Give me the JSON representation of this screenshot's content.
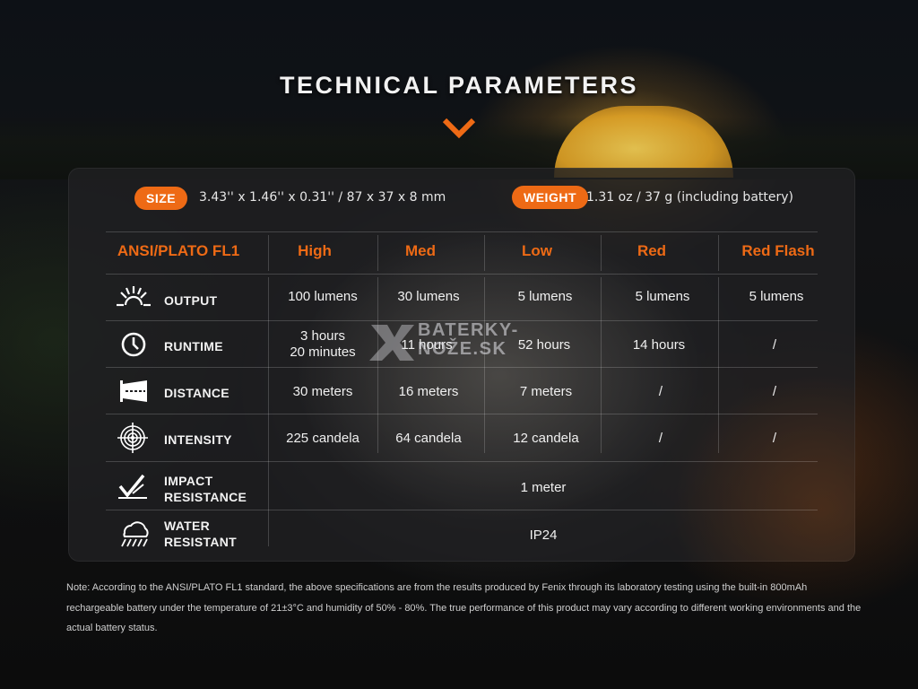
{
  "title": "TECHNICAL PARAMETERS",
  "specs": {
    "size_label": "SIZE",
    "size_value": "3.43'' x 1.46'' x 0.31'' / 87 x 37 x 8 mm",
    "weight_label": "WEIGHT",
    "weight_value": "1.31 oz / 37 g (including battery)"
  },
  "table": {
    "headers": [
      "ANSI/PLATO FL1",
      "High",
      "Med",
      "Low",
      "Red",
      "Red Flash"
    ],
    "rows": [
      {
        "label": "OUTPUT",
        "icon": "output-burst-icon",
        "cells": [
          "100 lumens",
          "30 lumens",
          "5 lumens",
          "5 lumens",
          "5 lumens"
        ]
      },
      {
        "label": "RUNTIME",
        "icon": "clock-icon",
        "cells": [
          "3 hours 20 minutes",
          "11 hours",
          "52 hours",
          "14 hours",
          "/"
        ]
      },
      {
        "label": "DISTANCE",
        "icon": "distance-icon",
        "cells": [
          "30 meters",
          "16 meters",
          "7 meters",
          "/",
          "/"
        ]
      },
      {
        "label": "INTENSITY",
        "icon": "target-icon",
        "cells": [
          "225 candela",
          "64 candela",
          "12 candela",
          "/",
          "/"
        ]
      },
      {
        "label_line1": "IMPACT",
        "label_line2": "RESISTANCE",
        "icon": "impact-icon",
        "value": "1 meter"
      },
      {
        "label_line1": "WATER",
        "label_line2": "RESISTANT",
        "icon": "rain-cloud-icon",
        "value": "IP24"
      }
    ]
  },
  "runtime_high_line1": "3 hours",
  "runtime_high_line2": "20 minutes",
  "watermark": {
    "line1": "BATERKY-",
    "line2": "NOŽE.SK"
  },
  "note": "Note: According to the ANSI/PLATO FL1 standard, the above specifications are from the results produced by Fenix through its laboratory testing using the built-in 800mAh rechargeable battery under the temperature of 21±3°C and humidity of 50% - 80%. The true performance of this product may vary according to different working environments and the actual battery status.",
  "colors": {
    "accent": "#ee6a15",
    "panel": "#202022",
    "text": "#f0f0f0"
  }
}
